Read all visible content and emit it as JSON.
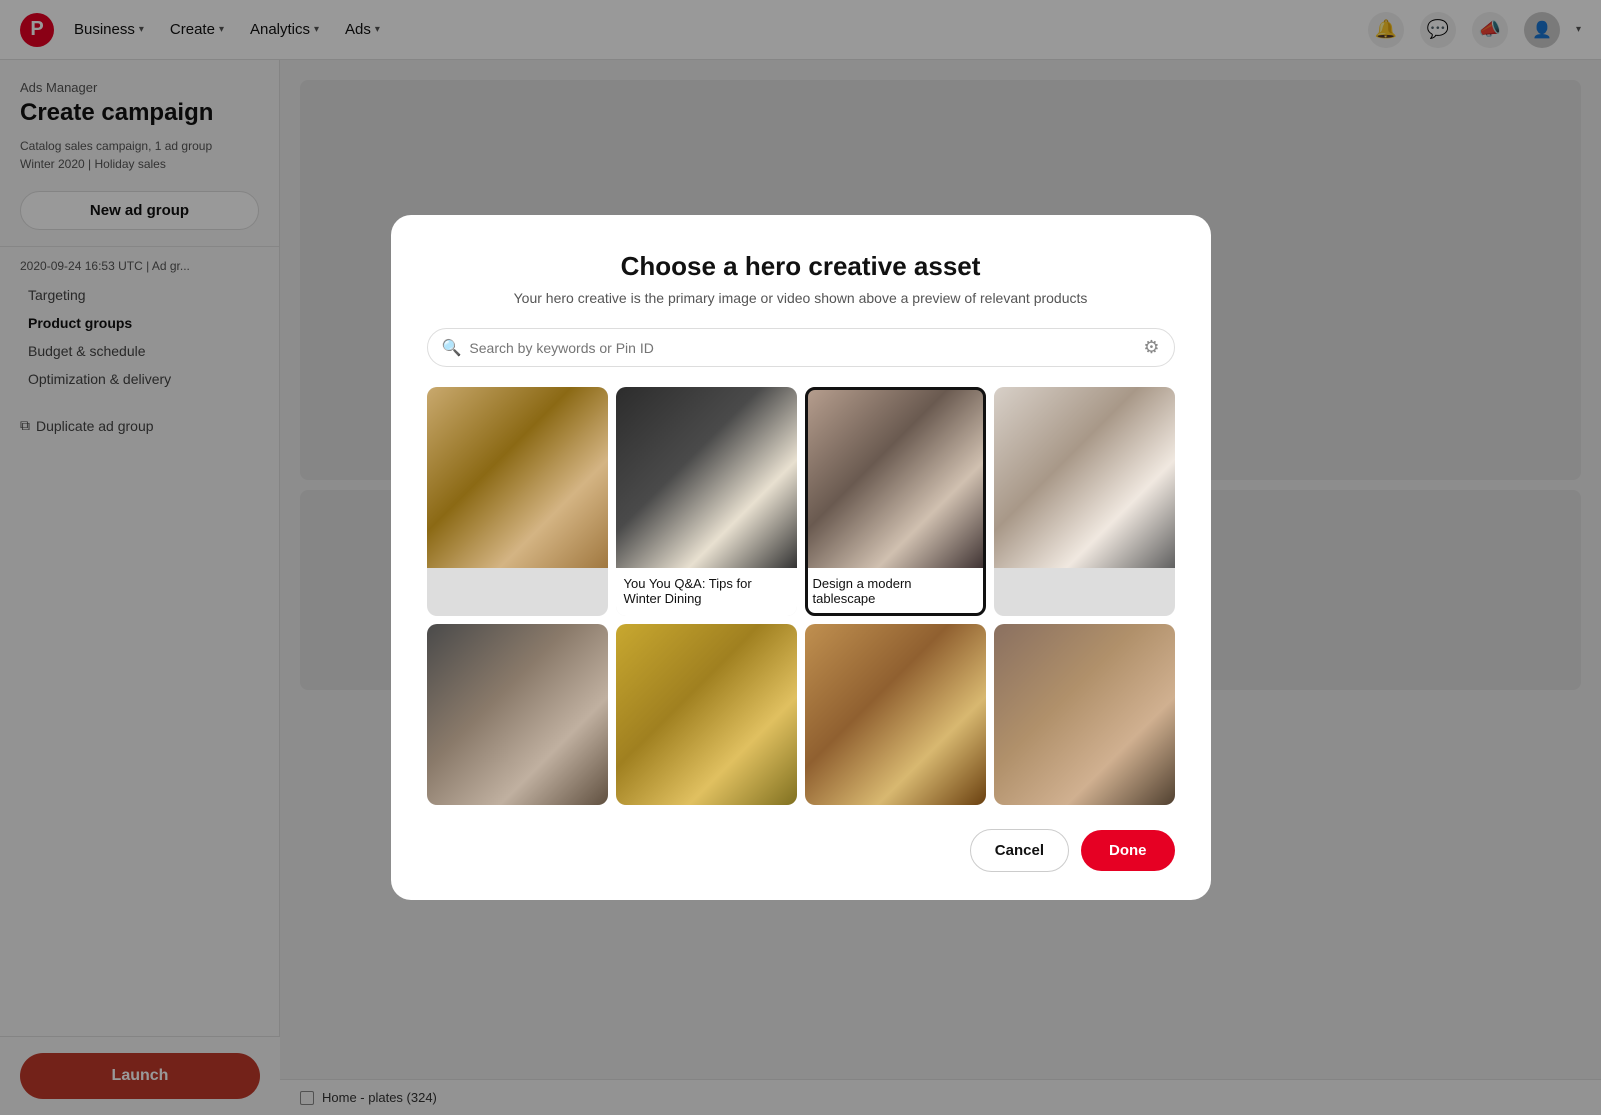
{
  "nav": {
    "logo_char": "P",
    "items": [
      {
        "label": "Business",
        "id": "business"
      },
      {
        "label": "Create",
        "id": "create"
      },
      {
        "label": "Analytics",
        "id": "analytics"
      },
      {
        "label": "Ads",
        "id": "ads"
      }
    ]
  },
  "sidebar": {
    "breadcrumb": "Ads Manager",
    "title": "Create campaign",
    "campaign_line1": "Catalog sales campaign, 1 ad group",
    "campaign_line2": "Winter 2020 | Holiday sales",
    "new_ad_group_label": "New ad group",
    "ad_group_meta": "2020-09-24 16:53 UTC  |  Ad gr...",
    "nav_items": [
      {
        "label": "Targeting",
        "active": false
      },
      {
        "label": "Product groups",
        "active": true
      },
      {
        "label": "Budget & schedule",
        "active": false
      },
      {
        "label": "Optimization & delivery",
        "active": false
      }
    ],
    "duplicate_label": "Duplicate ad group"
  },
  "launch_btn": "Launch",
  "modal": {
    "title": "Choose a hero creative asset",
    "subtitle": "Your hero creative is the primary image or video shown above a preview of relevant products",
    "search_placeholder": "Search by keywords or Pin ID",
    "images": [
      {
        "id": "img1",
        "caption": "",
        "selected": false,
        "css_class": "img-1"
      },
      {
        "id": "img2",
        "caption": "You You Q&A: Tips for Winter Dining",
        "selected": false,
        "css_class": "img-2"
      },
      {
        "id": "img3",
        "caption": "Design a modern tablescape",
        "selected": true,
        "css_class": "img-3"
      },
      {
        "id": "img4",
        "caption": "",
        "selected": false,
        "css_class": "img-4"
      },
      {
        "id": "img5",
        "caption": "",
        "selected": false,
        "css_class": "img-5"
      },
      {
        "id": "img6",
        "caption": "",
        "selected": false,
        "css_class": "img-6"
      },
      {
        "id": "img7",
        "caption": "",
        "selected": false,
        "css_class": "img-7"
      },
      {
        "id": "img8",
        "caption": "",
        "selected": false,
        "css_class": "img-8"
      }
    ],
    "cancel_label": "Cancel",
    "done_label": "Done"
  },
  "product_bar": {
    "label": "Home - plates (324)"
  }
}
